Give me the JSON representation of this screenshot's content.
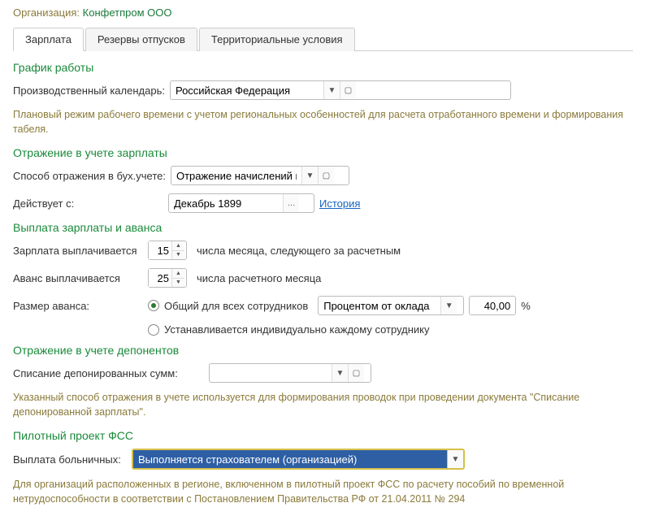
{
  "org": {
    "label": "Организация:",
    "value": "Конфетпром ООО"
  },
  "tabs": [
    {
      "label": "Зарплата"
    },
    {
      "label": "Резервы отпусков"
    },
    {
      "label": "Территориальные условия"
    }
  ],
  "schedule": {
    "title": "График работы",
    "calendar_label": "Производственный календарь:",
    "calendar_value": "Российская Федерация",
    "hint": "Плановый режим рабочего времени с учетом региональных особенностей для расчета отработанного времени и формирования табеля."
  },
  "salary_reflect": {
    "title": "Отражение в учете зарплаты",
    "method_label": "Способ отражения в бух.учете:",
    "method_value": "Отражение начислений по",
    "effective_label": "Действует с:",
    "effective_value": "Декабрь 1899",
    "history_link": "История"
  },
  "payout": {
    "title": "Выплата зарплаты и аванса",
    "salary_label": "Зарплата выплачивается",
    "salary_day": "15",
    "salary_post": "числа месяца, следующего за расчетным",
    "advance_label": "Аванс выплачивается",
    "advance_day": "25",
    "advance_post": "числа расчетного месяца",
    "amount_label": "Размер аванса:",
    "radio_common": "Общий для всех сотрудников",
    "radio_individual": "Устанавливается индивидуально каждому сотруднику",
    "percent_mode": "Процентом от оклада",
    "percent_value": "40,00",
    "percent_sign": "%"
  },
  "deponent": {
    "title": "Отражение в учете депонентов",
    "writeoff_label": "Списание депонированных сумм:",
    "writeoff_value": "",
    "hint": "Указанный способ отражения в учете используется для формирования проводок при проведении документа \"Списание депонированной зарплаты\"."
  },
  "fss": {
    "title": "Пилотный проект ФСС",
    "sick_label": "Выплата больничных:",
    "sick_value": "Выполняется страхователем (организацией)",
    "hint": "Для организаций расположенных в регионе, включенном в пилотный проект ФСС по расчету пособий по временной нетрудоспособности в соответствии с Постановлением Правительства РФ от 21.04.2011 № 294"
  }
}
